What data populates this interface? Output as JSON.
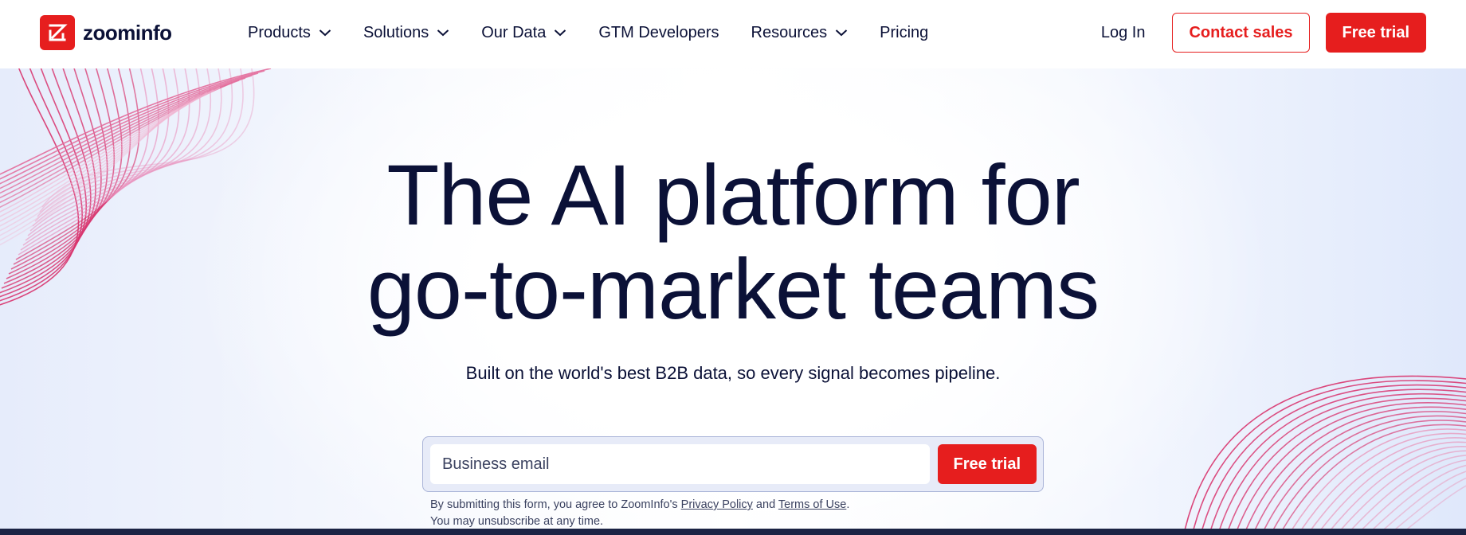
{
  "brand": {
    "name": "zoominfo",
    "accent": "#e61e1e",
    "ink": "#0b1137"
  },
  "nav": {
    "items": [
      {
        "label": "Products",
        "has_menu": true
      },
      {
        "label": "Solutions",
        "has_menu": true
      },
      {
        "label": "Our Data",
        "has_menu": true
      },
      {
        "label": "GTM Developers",
        "has_menu": false
      },
      {
        "label": "Resources",
        "has_menu": true
      },
      {
        "label": "Pricing",
        "has_menu": false
      }
    ]
  },
  "actions": {
    "login_label": "Log In",
    "contact_label": "Contact sales",
    "trial_label": "Free trial"
  },
  "hero": {
    "headline_line1": "The AI platform for",
    "headline_line2": "go-to-market teams",
    "subhead": "Built on the world's best B2B data, so every signal becomes pipeline."
  },
  "form": {
    "email_placeholder": "Business email",
    "submit_label": "Free trial",
    "legal_prefix": "By submitting this form, you agree to ZoomInfo's ",
    "privacy_label": "Privacy Policy",
    "legal_and": " and ",
    "terms_label": "Terms of Use",
    "legal_end": ".",
    "unsubscribe": "You may unsubscribe at any time."
  },
  "icons": [
    "zoominfo-logo-icon",
    "chevron-down-icon"
  ]
}
